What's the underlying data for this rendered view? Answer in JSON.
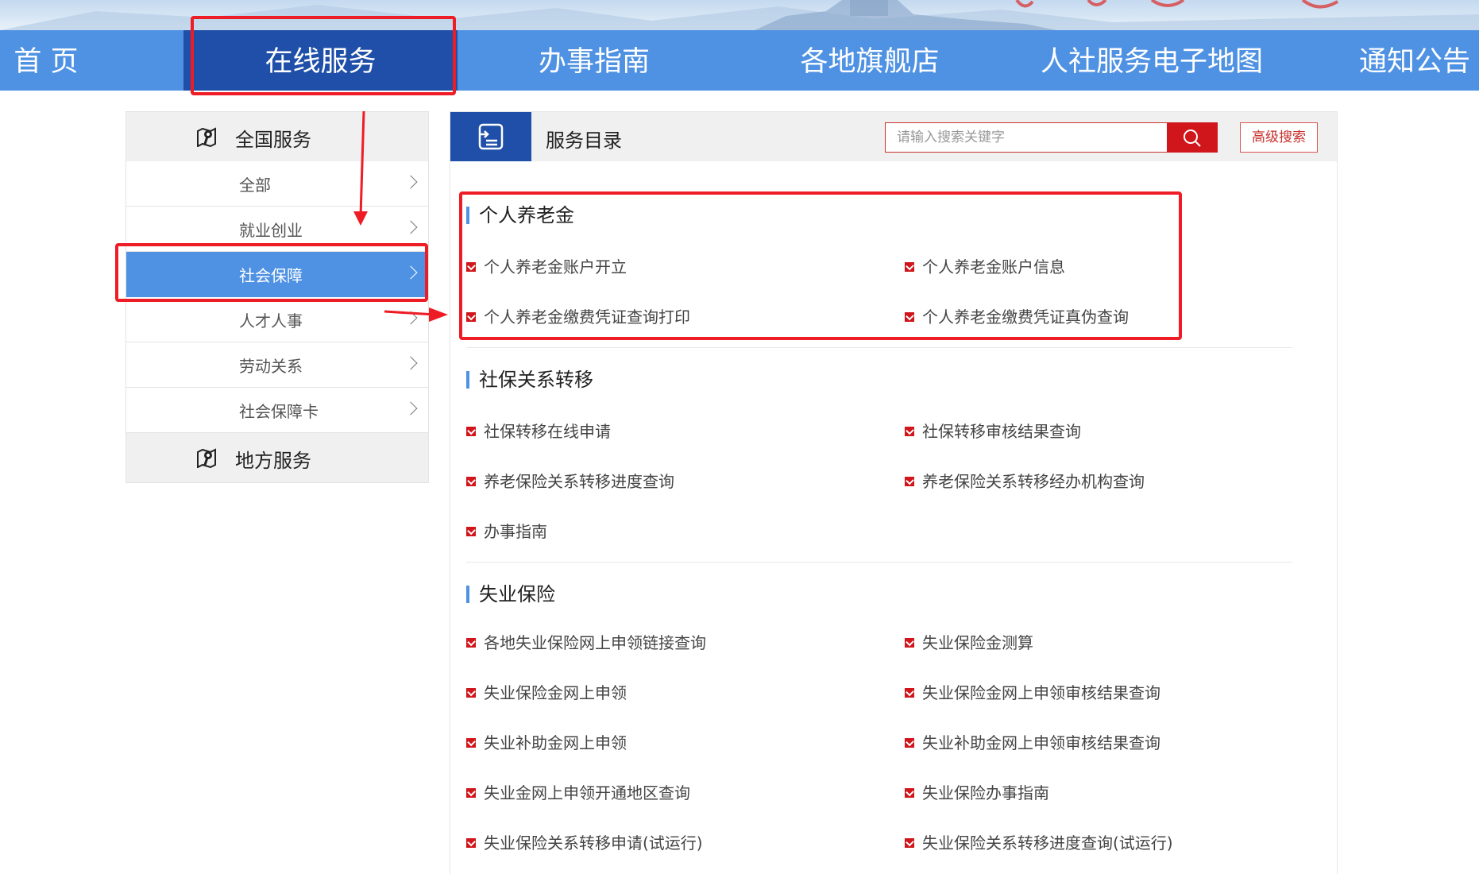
{
  "colors": {
    "nav_bg": "#4f92e3",
    "nav_active_bg": "#1f4fa8",
    "accent_red": "#d0151b",
    "annotation_red": "#ee1c25",
    "panel_header_bg": "#f0f0f0"
  },
  "nav": {
    "items": [
      {
        "label": "首 页"
      },
      {
        "label": "在线服务",
        "active": true
      },
      {
        "label": "办事指南"
      },
      {
        "label": "各地旗舰店"
      },
      {
        "label": "人社服务电子地图"
      },
      {
        "label": "通知公告"
      }
    ]
  },
  "sidebar": {
    "national_title": "全国服务",
    "national_icon": "map-marker-icon",
    "items": [
      {
        "label": "全部"
      },
      {
        "label": "就业创业"
      },
      {
        "label": "社会保障",
        "active": true
      },
      {
        "label": "人才人事"
      },
      {
        "label": "劳动关系"
      },
      {
        "label": "社会保障卡"
      }
    ],
    "local_title": "地方服务",
    "local_icon": "map-marker-icon"
  },
  "main": {
    "header_icon": "catalog-icon",
    "title": "服务目录",
    "search": {
      "placeholder": "请输入搜索关键字",
      "value": "",
      "icon": "search-icon"
    },
    "advanced_search_label": "高级搜索",
    "categories": [
      {
        "title": "个人养老金",
        "services": [
          "个人养老金账户开立",
          "个人养老金账户信息",
          "个人养老金缴费凭证查询打印",
          "个人养老金缴费凭证真伪查询"
        ]
      },
      {
        "title": "社保关系转移",
        "services": [
          "社保转移在线申请",
          "社保转移审核结果查询",
          "养老保险关系转移进度查询",
          "养老保险关系转移经办机构查询",
          "办事指南"
        ]
      },
      {
        "title": "失业保险",
        "services": [
          "各地失业保险网上申领链接查询",
          "失业保险金测算",
          "失业保险金网上申领",
          "失业保险金网上申领审核结果查询",
          "失业补助金网上申领",
          "失业补助金网上申领审核结果查询",
          "失业金网上申领开通地区查询",
          "失业保险办事指南",
          "失业保险关系转移申请(试运行)",
          "失业保险关系转移进度查询(试运行)"
        ]
      }
    ]
  }
}
